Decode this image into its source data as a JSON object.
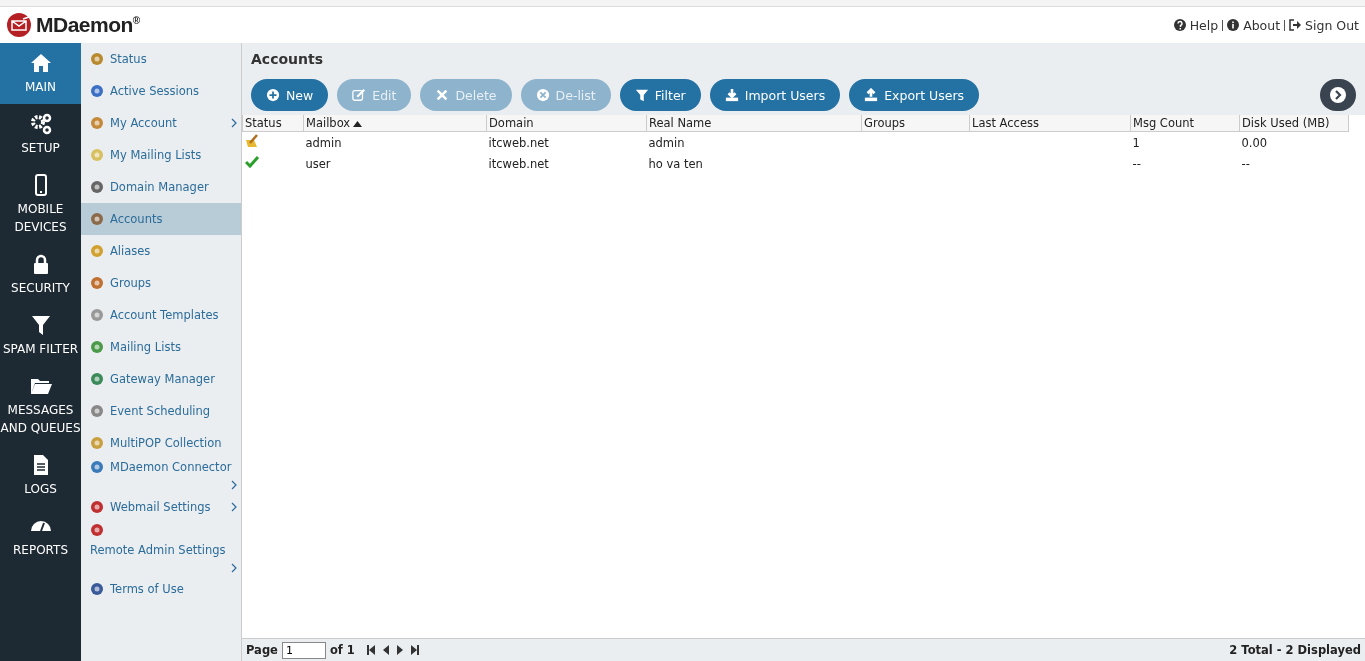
{
  "header": {
    "logo": "MDaemon",
    "logo_mark": "®",
    "links": [
      {
        "label": "Help"
      },
      {
        "label": "About"
      },
      {
        "label": "Sign Out"
      }
    ]
  },
  "nav": [
    {
      "label": "MAIN",
      "selected": true
    },
    {
      "label": "SETUP",
      "selected": false
    },
    {
      "label": "MOBILE DEVICES",
      "selected": false
    },
    {
      "label": "SECURITY",
      "selected": false
    },
    {
      "label": "SPAM FILTER",
      "selected": false
    },
    {
      "label": "MESSAGES AND QUEUES",
      "selected": false
    },
    {
      "label": "LOGS",
      "selected": false
    },
    {
      "label": "REPORTS",
      "selected": false
    }
  ],
  "menu": [
    {
      "label": "Status",
      "selected": false,
      "submenu": false
    },
    {
      "label": "Active Sessions",
      "selected": false,
      "submenu": false
    },
    {
      "label": "My Account",
      "selected": false,
      "submenu": true
    },
    {
      "label": "My Mailing Lists",
      "selected": false,
      "submenu": false
    },
    {
      "label": "Domain Manager",
      "selected": false,
      "submenu": false
    },
    {
      "label": "Accounts",
      "selected": true,
      "submenu": false
    },
    {
      "label": "Aliases",
      "selected": false,
      "submenu": false
    },
    {
      "label": "Groups",
      "selected": false,
      "submenu": false
    },
    {
      "label": "Account Templates",
      "selected": false,
      "submenu": false
    },
    {
      "label": "Mailing Lists",
      "selected": false,
      "submenu": false
    },
    {
      "label": "Gateway Manager",
      "selected": false,
      "submenu": false
    },
    {
      "label": "Event Scheduling",
      "selected": false,
      "submenu": false
    },
    {
      "label": "MultiPOP Collection",
      "selected": false,
      "submenu": false
    },
    {
      "label": "MDaemon Connector",
      "selected": false,
      "submenu": true
    },
    {
      "label": "Webmail Settings",
      "selected": false,
      "submenu": true
    },
    {
      "label": "Remote Admin Settings",
      "selected": false,
      "submenu": true
    },
    {
      "label": "Terms of Use",
      "selected": false,
      "submenu": false
    }
  ],
  "page_title": "Accounts",
  "toolbar": [
    {
      "label": "New",
      "disabled": false
    },
    {
      "label": "Edit",
      "disabled": true
    },
    {
      "label": "Delete",
      "disabled": true
    },
    {
      "label": "De-list",
      "disabled": true
    },
    {
      "label": "Filter",
      "disabled": false
    },
    {
      "label": "Import Users",
      "disabled": false
    },
    {
      "label": "Export Users",
      "disabled": false
    }
  ],
  "table": {
    "columns": [
      {
        "label": "Status",
        "sorted": false
      },
      {
        "label": "Mailbox",
        "sorted": true
      },
      {
        "label": "Domain",
        "sorted": false
      },
      {
        "label": "Real Name",
        "sorted": false
      },
      {
        "label": "Groups",
        "sorted": false
      },
      {
        "label": "Last Access",
        "sorted": false
      },
      {
        "label": "Msg Count",
        "sorted": false
      },
      {
        "label": "Disk Used (MB)",
        "sorted": false
      }
    ],
    "rows": [
      {
        "kind": "admin",
        "cells": [
          "",
          "admin",
          "itcweb.net",
          "admin",
          "",
          "",
          "1",
          "0.00"
        ]
      },
      {
        "kind": "user",
        "cells": [
          "",
          "user",
          "itcweb.net",
          "ho va ten",
          "",
          "",
          "--",
          "--"
        ]
      }
    ]
  },
  "pager": {
    "page_label": "Page",
    "page_value": "1",
    "of_label": "of 1",
    "summary": "2 Total - 2 Displayed"
  }
}
